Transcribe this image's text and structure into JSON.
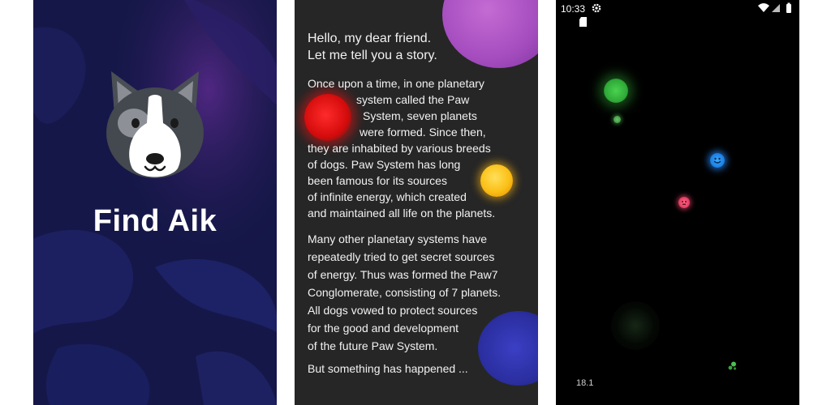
{
  "splash": {
    "app_title": "Find Aik",
    "logo_icon": "husky-dog-icon",
    "colors": {
      "background": "#151748",
      "accent": "#5a2a8c"
    }
  },
  "story": {
    "greeting": [
      "Hello, my dear friend.",
      "Let me tell you a story."
    ],
    "paragraph1": [
      "Once upon a time, in one planetary",
      "system called the Paw",
      "System, seven planets",
      "were formed. Since then,",
      "they are inhabited by various breeds",
      "of dogs. Paw System has long",
      "been famous for its sources",
      "of infinite energy, which created",
      "and maintained all life on the planets."
    ],
    "paragraph2": [
      "Many other planetary systems have",
      "repeatedly tried to get secret sources",
      "of energy. Thus was formed the Paw7",
      "Conglomerate, consisting of 7 planets.",
      "All dogs vowed to protect sources",
      "for the good and development",
      "of the future Paw System."
    ],
    "closing": "But something has happened ...",
    "colors": {
      "background": "#262626",
      "planet_purple": "#a54dbf",
      "planet_red": "#d40b0b",
      "planet_yellow": "#fbbf16",
      "planet_blue": "#2a2e9e"
    }
  },
  "game": {
    "status_bar": {
      "time": "10:33",
      "left_icons": [
        "settings-icon",
        "sd-card-icon"
      ],
      "right_icons": [
        "wifi-icon",
        "signal-icon",
        "battery-icon"
      ]
    },
    "score": "18.1",
    "colors": {
      "background": "#000000",
      "orb_green": "#2ea837",
      "orb_blue": "#1a7de0",
      "orb_pink": "#e13a5e"
    }
  }
}
